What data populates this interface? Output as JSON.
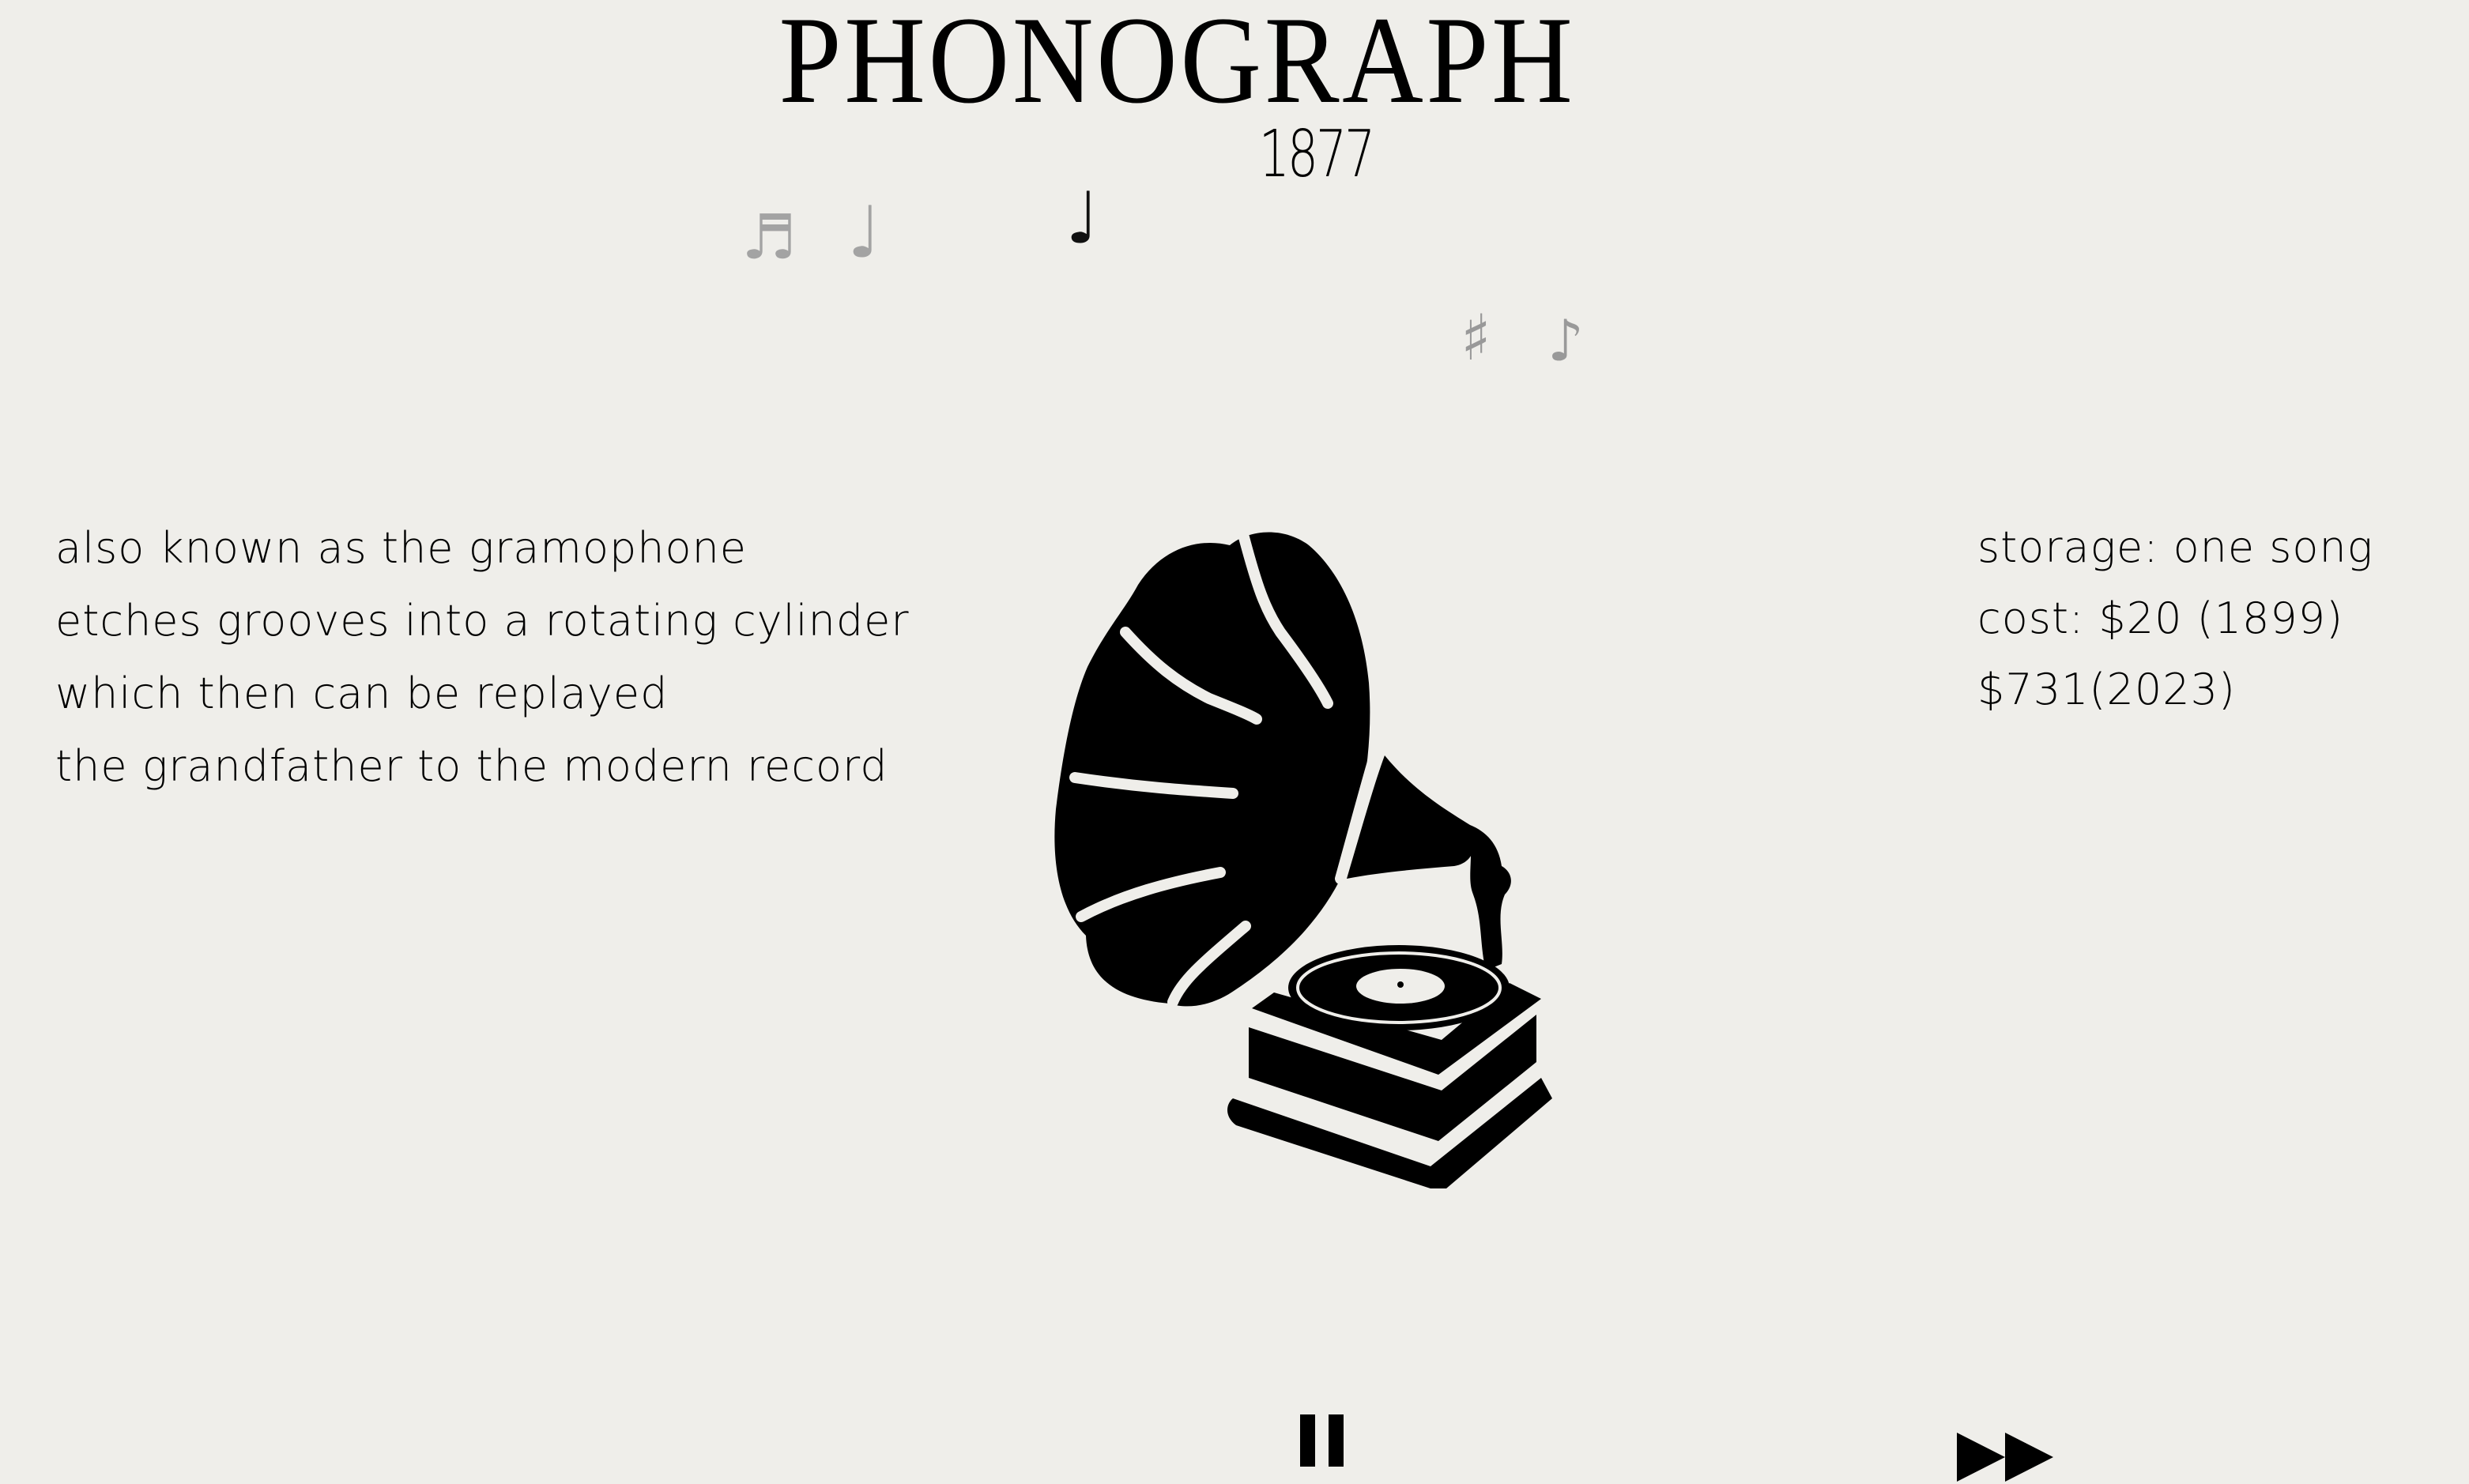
{
  "header": {
    "title": "PHONOGRAPH",
    "year": "1877"
  },
  "notes": [
    {
      "glyph": "♬",
      "color": "#a3a3a3"
    },
    {
      "glyph": "♩",
      "color": "#a3a3a3"
    },
    {
      "glyph": "♩",
      "color": "#111111"
    },
    {
      "glyph": "♯",
      "color": "#999999"
    },
    {
      "glyph": "♪",
      "color": "#999999"
    }
  ],
  "description": [
    "also known as the gramophone",
    "etches grooves into a rotating cylinder",
    "which then can be replayed",
    "the grandfather to the modern record"
  ],
  "stats": [
    "storage: one song",
    "cost: $20 (1899)",
    "$731(2023)"
  ],
  "controls": {
    "pause": "pause-icon",
    "fast_forward": "fast-forward-icon"
  },
  "colors": {
    "background": "#efeeea",
    "ink": "#000000"
  }
}
